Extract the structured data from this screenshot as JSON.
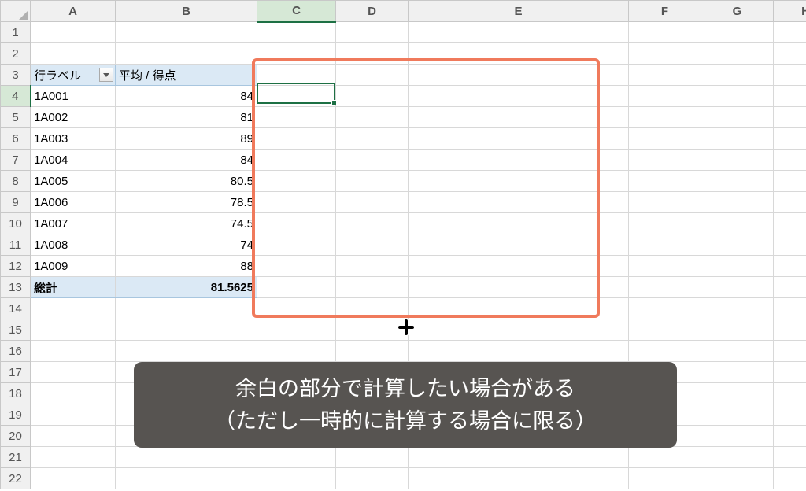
{
  "columns": [
    "A",
    "B",
    "C",
    "D",
    "E",
    "F",
    "G",
    "H"
  ],
  "rowCount": 22,
  "activeCol": "C",
  "activeRow": 4,
  "pivot": {
    "headerRow": 3,
    "rowLabelHeader": "行ラベル",
    "valueHeader": "平均 / 得点",
    "rows": [
      {
        "label": "1A001",
        "value": "84"
      },
      {
        "label": "1A002",
        "value": "81"
      },
      {
        "label": "1A003",
        "value": "89"
      },
      {
        "label": "1A004",
        "value": "84"
      },
      {
        "label": "1A005",
        "value": "80.5"
      },
      {
        "label": "1A006",
        "value": "78.5"
      },
      {
        "label": "1A007",
        "value": "74.5"
      },
      {
        "label": "1A008",
        "value": "74"
      },
      {
        "label": "1A009",
        "value": "88"
      }
    ],
    "totalLabel": "総計",
    "totalValue": "81.5625"
  },
  "caption": {
    "line1": "余白の部分で計算したい場合がある",
    "line2": "（ただし一時的に計算する場合に限る）"
  }
}
